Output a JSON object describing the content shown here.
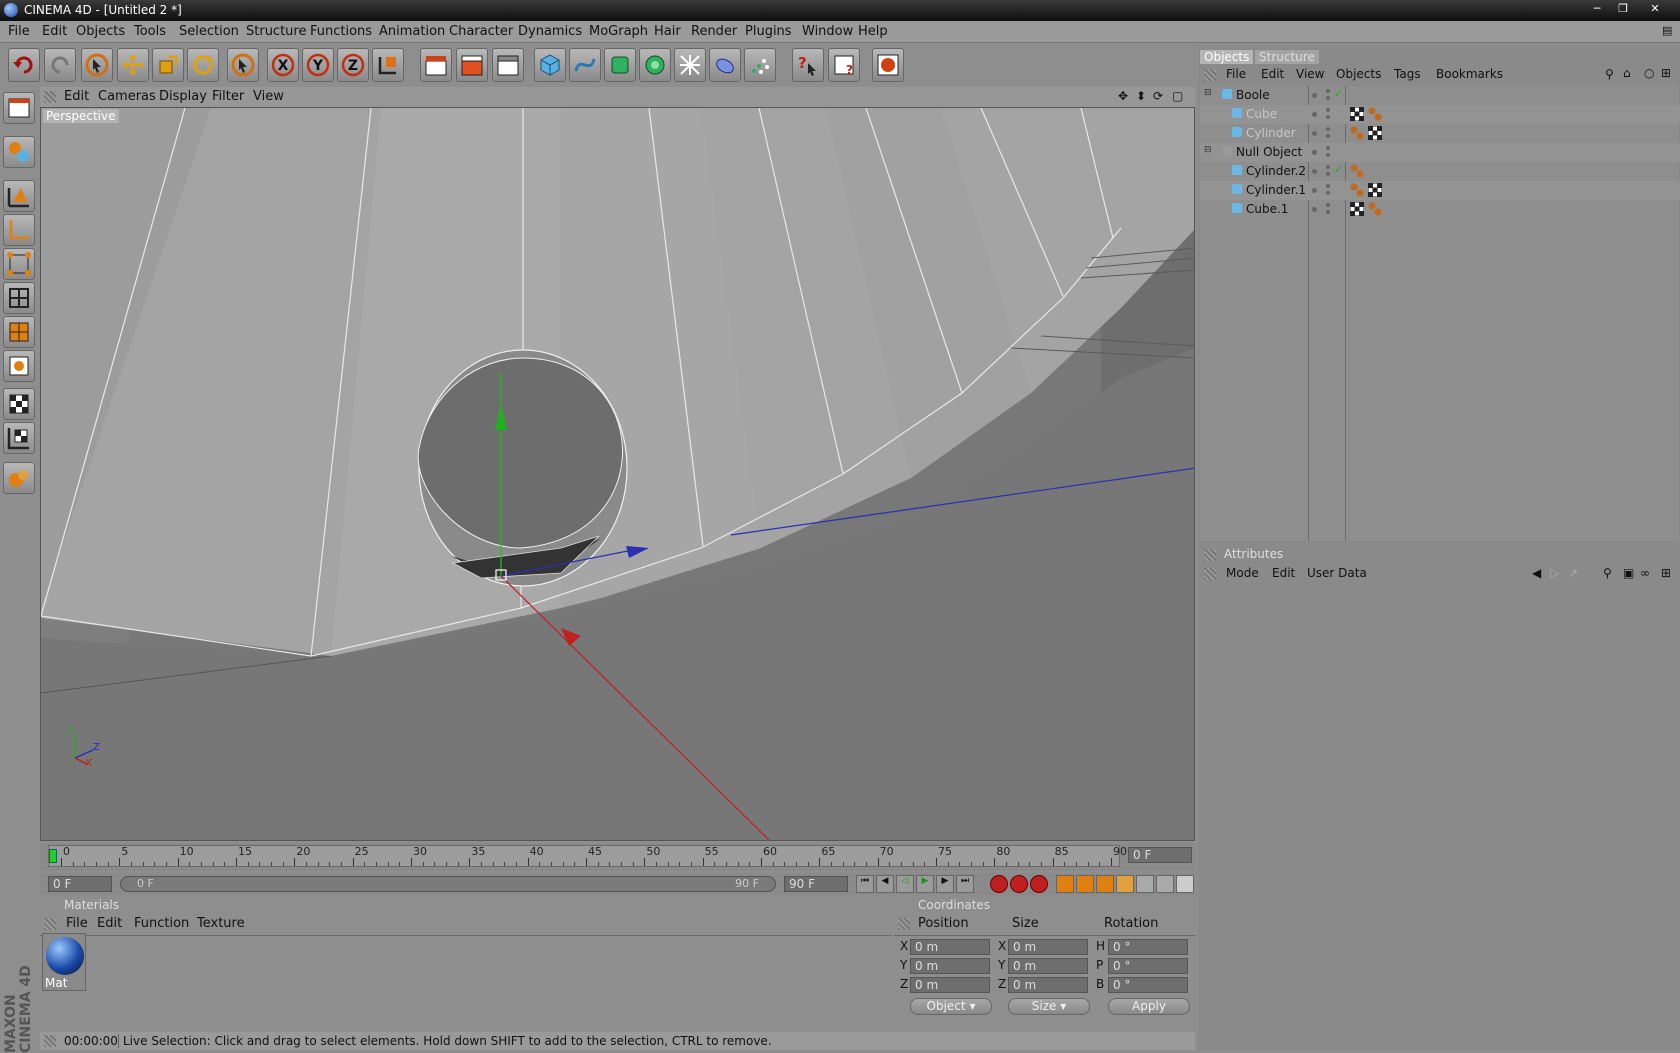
{
  "window": {
    "title": "CINEMA 4D - [Untitled 2 *]",
    "minimize_icon": "minimize-icon",
    "maximize_icon": "maximize-icon",
    "close_icon": "close-icon"
  },
  "menu": [
    "File",
    "Edit",
    "Objects",
    "Tools",
    "Selection",
    "Structure",
    "Functions",
    "Animation",
    "Character",
    "Dynamics",
    "MoGraph",
    "Hair",
    "Render",
    "Plugins",
    "Window",
    "Help"
  ],
  "viewport": {
    "menu": [
      "Edit",
      "Cameras",
      "Display",
      "Filter",
      "View"
    ],
    "label": "Perspective",
    "axis": {
      "y": "Y",
      "z": "Z",
      "x": "X"
    }
  },
  "timeline": {
    "ticks": [
      "0",
      "5",
      "10",
      "15",
      "20",
      "25",
      "30",
      "35",
      "40",
      "45",
      "50",
      "55",
      "60",
      "65",
      "70",
      "75",
      "80",
      "85",
      "90"
    ],
    "current_frame": "0 F"
  },
  "animation": {
    "start": "0 F",
    "range_start": "0 F",
    "range_end": "90 F",
    "end": "90 F"
  },
  "materials": {
    "header": "Materials",
    "menu": [
      "File",
      "Edit",
      "Function",
      "Texture"
    ],
    "items": [
      {
        "name": "Mat"
      }
    ]
  },
  "coordinates": {
    "header": "Coordinates",
    "columns": [
      "Position",
      "Size",
      "Rotation"
    ],
    "rows": [
      {
        "axis": "X",
        "pos": "0 m",
        "size_axis": "X",
        "size": "0 m",
        "rot_axis": "H",
        "rot": "0 °"
      },
      {
        "axis": "Y",
        "pos": "0 m",
        "size_axis": "Y",
        "size": "0 m",
        "rot_axis": "P",
        "rot": "0 °"
      },
      {
        "axis": "Z",
        "pos": "0 m",
        "size_axis": "Z",
        "size": "0 m",
        "rot_axis": "B",
        "rot": "0 °"
      }
    ],
    "mode_select": "Object",
    "size_select": "Size",
    "apply": "Apply"
  },
  "status": {
    "time": "00:00:00",
    "text": "Live Selection: Click and drag to select elements. Hold down SHIFT to add to the selection, CTRL to remove."
  },
  "branding": "MAXON CINEMA 4D",
  "object_manager": {
    "tabs": [
      "Objects",
      "Structure"
    ],
    "menu": [
      "File",
      "Edit",
      "View",
      "Objects",
      "Tags",
      "Bookmarks"
    ],
    "objects": [
      {
        "name": "Boole",
        "indent": 0,
        "dimmed": false,
        "check": true,
        "tags": []
      },
      {
        "name": "Cube",
        "indent": 1,
        "dimmed": true,
        "check": false,
        "tags": [
          "checker",
          "phong"
        ]
      },
      {
        "name": "Cylinder",
        "indent": 1,
        "dimmed": true,
        "check": false,
        "tags": [
          "phong",
          "checker"
        ]
      },
      {
        "name": "Null Object",
        "indent": 0,
        "dimmed": false,
        "check": false,
        "tags": []
      },
      {
        "name": "Cylinder.2",
        "indent": 1,
        "dimmed": false,
        "check": true,
        "tags": [
          "phong"
        ]
      },
      {
        "name": "Cylinder.1",
        "indent": 1,
        "dimmed": false,
        "check": false,
        "tags": [
          "phong",
          "checker"
        ]
      },
      {
        "name": "Cube.1",
        "indent": 1,
        "dimmed": false,
        "check": false,
        "tags": [
          "checker",
          "phong"
        ]
      }
    ]
  },
  "attributes": {
    "header": "Attributes",
    "menu": [
      "Mode",
      "Edit",
      "User Data"
    ]
  },
  "colors": {
    "accent_x": "#d42020",
    "accent_y": "#20b020",
    "accent_z": "#2030c0",
    "active_tab": "#b5b5b5"
  }
}
